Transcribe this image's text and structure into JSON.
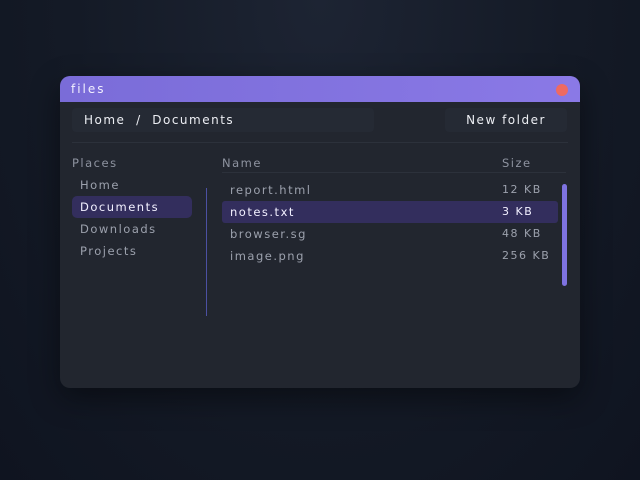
{
  "window": {
    "title": "files"
  },
  "toolbar": {
    "path": "Home  /  Documents",
    "new_folder_label": "New folder"
  },
  "sidebar": {
    "heading": "Places",
    "items": [
      {
        "label": "Home"
      },
      {
        "label": "Documents"
      },
      {
        "label": "Downloads"
      },
      {
        "label": "Projects"
      }
    ],
    "selected": "Documents"
  },
  "file_list": {
    "columns": {
      "name": "Name",
      "size": "Size"
    },
    "rows": [
      {
        "name": "report.html",
        "size": "12 KB"
      },
      {
        "name": "notes.txt",
        "size": "3 KB"
      },
      {
        "name": "browser.sg",
        "size": "48 KB"
      },
      {
        "name": "image.png",
        "size": "256 KB"
      }
    ],
    "selected": "notes.txt"
  },
  "colors": {
    "accent": "#7a6cd8",
    "close": "#ee6a62",
    "selection": "#332e5d",
    "window_bg": "#22262f"
  }
}
